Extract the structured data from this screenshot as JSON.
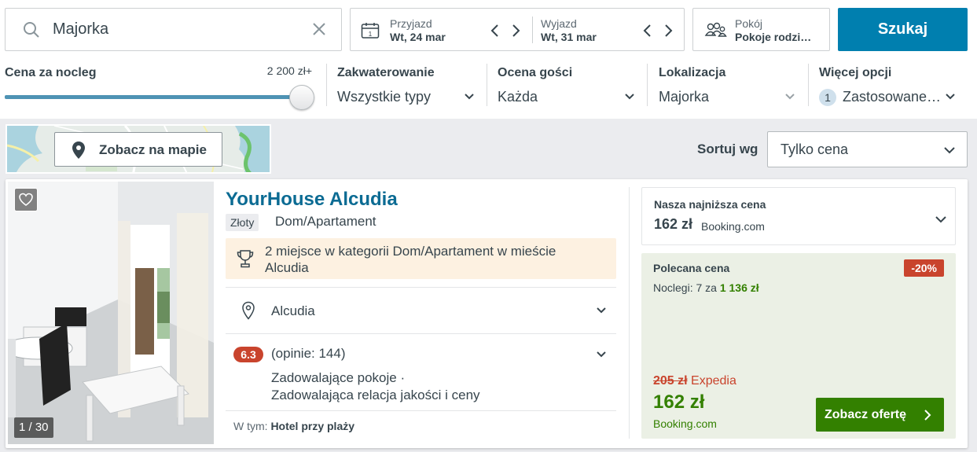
{
  "search": {
    "query": "Majorka"
  },
  "dates": {
    "checkin_label": "Przyjazd",
    "checkin_value": "Wt, 24 mar",
    "checkout_label": "Wyjazd",
    "checkout_value": "Wt, 31 mar",
    "calendar_day": "1"
  },
  "rooms": {
    "label": "Pokój",
    "value": "Pokoje rodzi…"
  },
  "search_button": "Szukaj",
  "filters": {
    "price": {
      "title": "Cena za nocleg",
      "max": "2 200 zł+"
    },
    "accommodation": {
      "title": "Zakwaterowanie",
      "value": "Wszystkie typy"
    },
    "rating": {
      "title": "Ocena gości",
      "value": "Każda"
    },
    "location": {
      "title": "Lokalizacja",
      "value": "Majorka"
    },
    "more": {
      "title": "Więcej opcji",
      "count": "1",
      "value": "Zastosowane…"
    }
  },
  "map_button": "Zobacz na mapie",
  "sort": {
    "label": "Sortuj wg",
    "value": "Tylko cena"
  },
  "hotel": {
    "name": "YourHouse Alcudia",
    "tier": "Złoty",
    "type": "Dom/Apartament",
    "award": "2 miejsce w kategorii Dom/Apartament w mieście Alcudia",
    "location": "Alcudia",
    "score": "6.3",
    "reviews": "(opinie: 144)",
    "review_line1": "Zadowalające pokoje ·",
    "review_line2": "Zadowalająca relacja jakości i ceny",
    "includes_label": "W tym:",
    "includes_value": "Hotel przy plaży",
    "photo_counter": "1 / 30"
  },
  "lowest": {
    "title": "Nasza najniższa cena",
    "price": "162 zł",
    "provider": "Booking.com"
  },
  "offer": {
    "title": "Polecana cena",
    "discount": "-20%",
    "nights_prefix": "Noclegi: 7 za",
    "nights_total": "1 136 zł",
    "old_price": "205 zł",
    "old_provider": "Expedia",
    "price": "162 zł",
    "provider": "Booking.com",
    "cta": "Zobacz ofertę"
  },
  "colors": {
    "brand_blue": "#007faf",
    "offer_green": "#338000",
    "alert_red": "#c9442d"
  }
}
